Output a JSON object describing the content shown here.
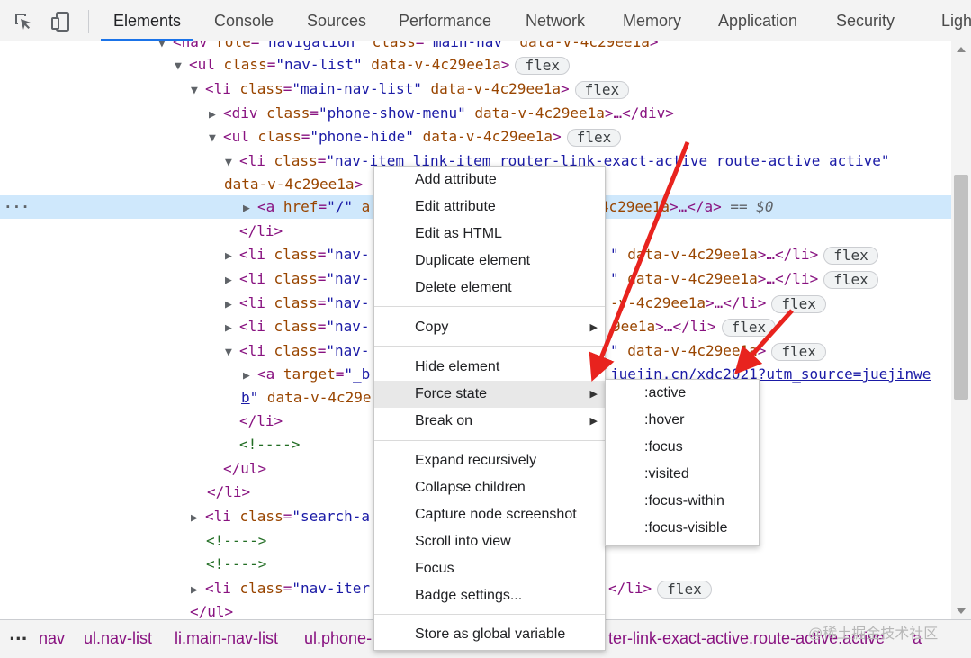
{
  "tabs": [
    "Elements",
    "Console",
    "Sources",
    "Performance",
    "Network",
    "Memory",
    "Application",
    "Security",
    "Ligh"
  ],
  "tree": {
    "l0": {
      "tag_open": "<nav ",
      "a1n": "role",
      "a1v": "\"navigation\"",
      "a2n": " class",
      "a2v": "\"main-nav\"",
      "a3n": " data-v-4c29ee1a",
      "tag_close": ">"
    },
    "l1": {
      "tag_open": "<ul ",
      "a1n": "class",
      "eq": "=",
      "a1v": "\"nav-list\"",
      "a2n": " data-v-4c29ee1a",
      "tag_close": ">",
      "badge": "flex"
    },
    "l2": {
      "tag_open": "<li ",
      "a1n": "class",
      "eq": "=",
      "a1v": "\"main-nav-list\"",
      "a2n": " data-v-4c29ee1a",
      "tag_close": ">",
      "badge": "flex"
    },
    "l3": {
      "tag_open": "<div ",
      "a1n": "class",
      "eq": "=",
      "a1v": "\"phone-show-menu\"",
      "a2n": " data-v-4c29ee1a",
      "tag_close": ">…</div>"
    },
    "l4": {
      "tag_open": "<ul ",
      "a1n": "class",
      "eq": "=",
      "a1v": "\"phone-hide\"",
      "a2n": " data-v-4c29ee1a",
      "tag_close": ">",
      "badge": "flex"
    },
    "l5": {
      "tag_open": "<li ",
      "a1n": "class",
      "eq": "=",
      "a1v": "\"nav-item link-item router-link-exact-active route-active active\""
    },
    "l6": {
      "a1n": "data-v-4c29ee1a",
      "tag_close": ">"
    },
    "l7": {
      "tag_open": "<a ",
      "a1n": "href",
      "eq": "=",
      "a1v": "\"/\"",
      "a2n": " a",
      "mid": "4c29ee1a",
      "tag_close": ">…</a>",
      "ref": " == $0",
      "dots": "···"
    },
    "l8": {
      "tag": "</li>"
    },
    "l9": {
      "tag_open": "<li ",
      "a1n": "class",
      "eq": "=",
      "a1v": "\"nav-",
      "tail_v": "\"",
      "a2n": " data-v-4c29ee1a",
      "tag_close": ">…</li>",
      "badge": "flex"
    },
    "l10": {
      "tag_open": "<li ",
      "a1n": "class",
      "eq": "=",
      "a1v": "\"nav-",
      "tail_v": "\"",
      "a2n": " data-v-4c29ee1a",
      "tag_close": ">…</li>",
      "badge": "flex"
    },
    "l11": {
      "tag_open": "<li ",
      "a1n": "class",
      "eq": "=",
      "a1v": "\"nav-",
      "a2n": "-v-4c29ee1a",
      "tag_close": ">…</li>",
      "badge": "flex"
    },
    "l12": {
      "tag_open": "<li ",
      "a1n": "class",
      "eq": "=",
      "a1v": "\"nav-",
      "a2n": "9ee1a",
      "tag_close": ">…</li>",
      "badge": "flex"
    },
    "l13": {
      "tag_open": "<li ",
      "a1n": "class",
      "eq": "=",
      "a1v": "\"nav-",
      "tail_v": "\"",
      "a2n": " data-v-4c29ee1a",
      "tag_close": ">",
      "badge": "flex"
    },
    "l14": {
      "tag_open": "<a ",
      "a1n": "target",
      "eq": "=",
      "a1v": "\"_b",
      "link": "juejin.cn/xdc2021?utm_source=juejinwe"
    },
    "l15": {
      "link": "b",
      "a1v": "\"",
      "a2n": " data-v-4c29e"
    },
    "l16": {
      "tag": "</li>"
    },
    "l17": {
      "comment": "<!---->"
    },
    "l18": {
      "tag": "</ul>"
    },
    "l19": {
      "tag": "</li>"
    },
    "l20": {
      "tag_open": "<li ",
      "a1n": "class",
      "eq": "=",
      "a1v": "\"search-a"
    },
    "l21": {
      "comment": "<!---->"
    },
    "l22": {
      "comment": "<!---->"
    },
    "l23": {
      "tag_open": "<li ",
      "a1n": "class",
      "eq": "=",
      "a1v": "\"nav-iter",
      "tag_close": "</li>",
      "badge": "flex"
    },
    "l24": {
      "tag": "</ul>"
    }
  },
  "breadcrumb": {
    "dots": "...",
    "items": [
      "nav",
      "ul.nav-list",
      "li.main-nav-list",
      "ul.phone-",
      "ter-link-exact-active.route-active.active",
      "a"
    ]
  },
  "watermark": "@稀土掘金技术社区",
  "context_menu": {
    "items": [
      "Add attribute",
      "Edit attribute",
      "Edit as HTML",
      "Duplicate element",
      "Delete element",
      "Copy",
      "Hide element",
      "Force state",
      "Break on",
      "Expand recursively",
      "Collapse children",
      "Capture node screenshot",
      "Scroll into view",
      "Focus",
      "Badge settings...",
      "Store as global variable"
    ]
  },
  "force_state_submenu": {
    "items": [
      ":active",
      ":hover",
      ":focus",
      ":visited",
      ":focus-within",
      ":focus-visible"
    ]
  },
  "colors": {
    "accent": "#1a73e8",
    "selected_row": "#cfe8fc",
    "tag": "#881280",
    "attr_name": "#994500",
    "attr_value": "#1a1aa6",
    "comment": "#236e25",
    "annotation_arrow": "#e8231e"
  }
}
